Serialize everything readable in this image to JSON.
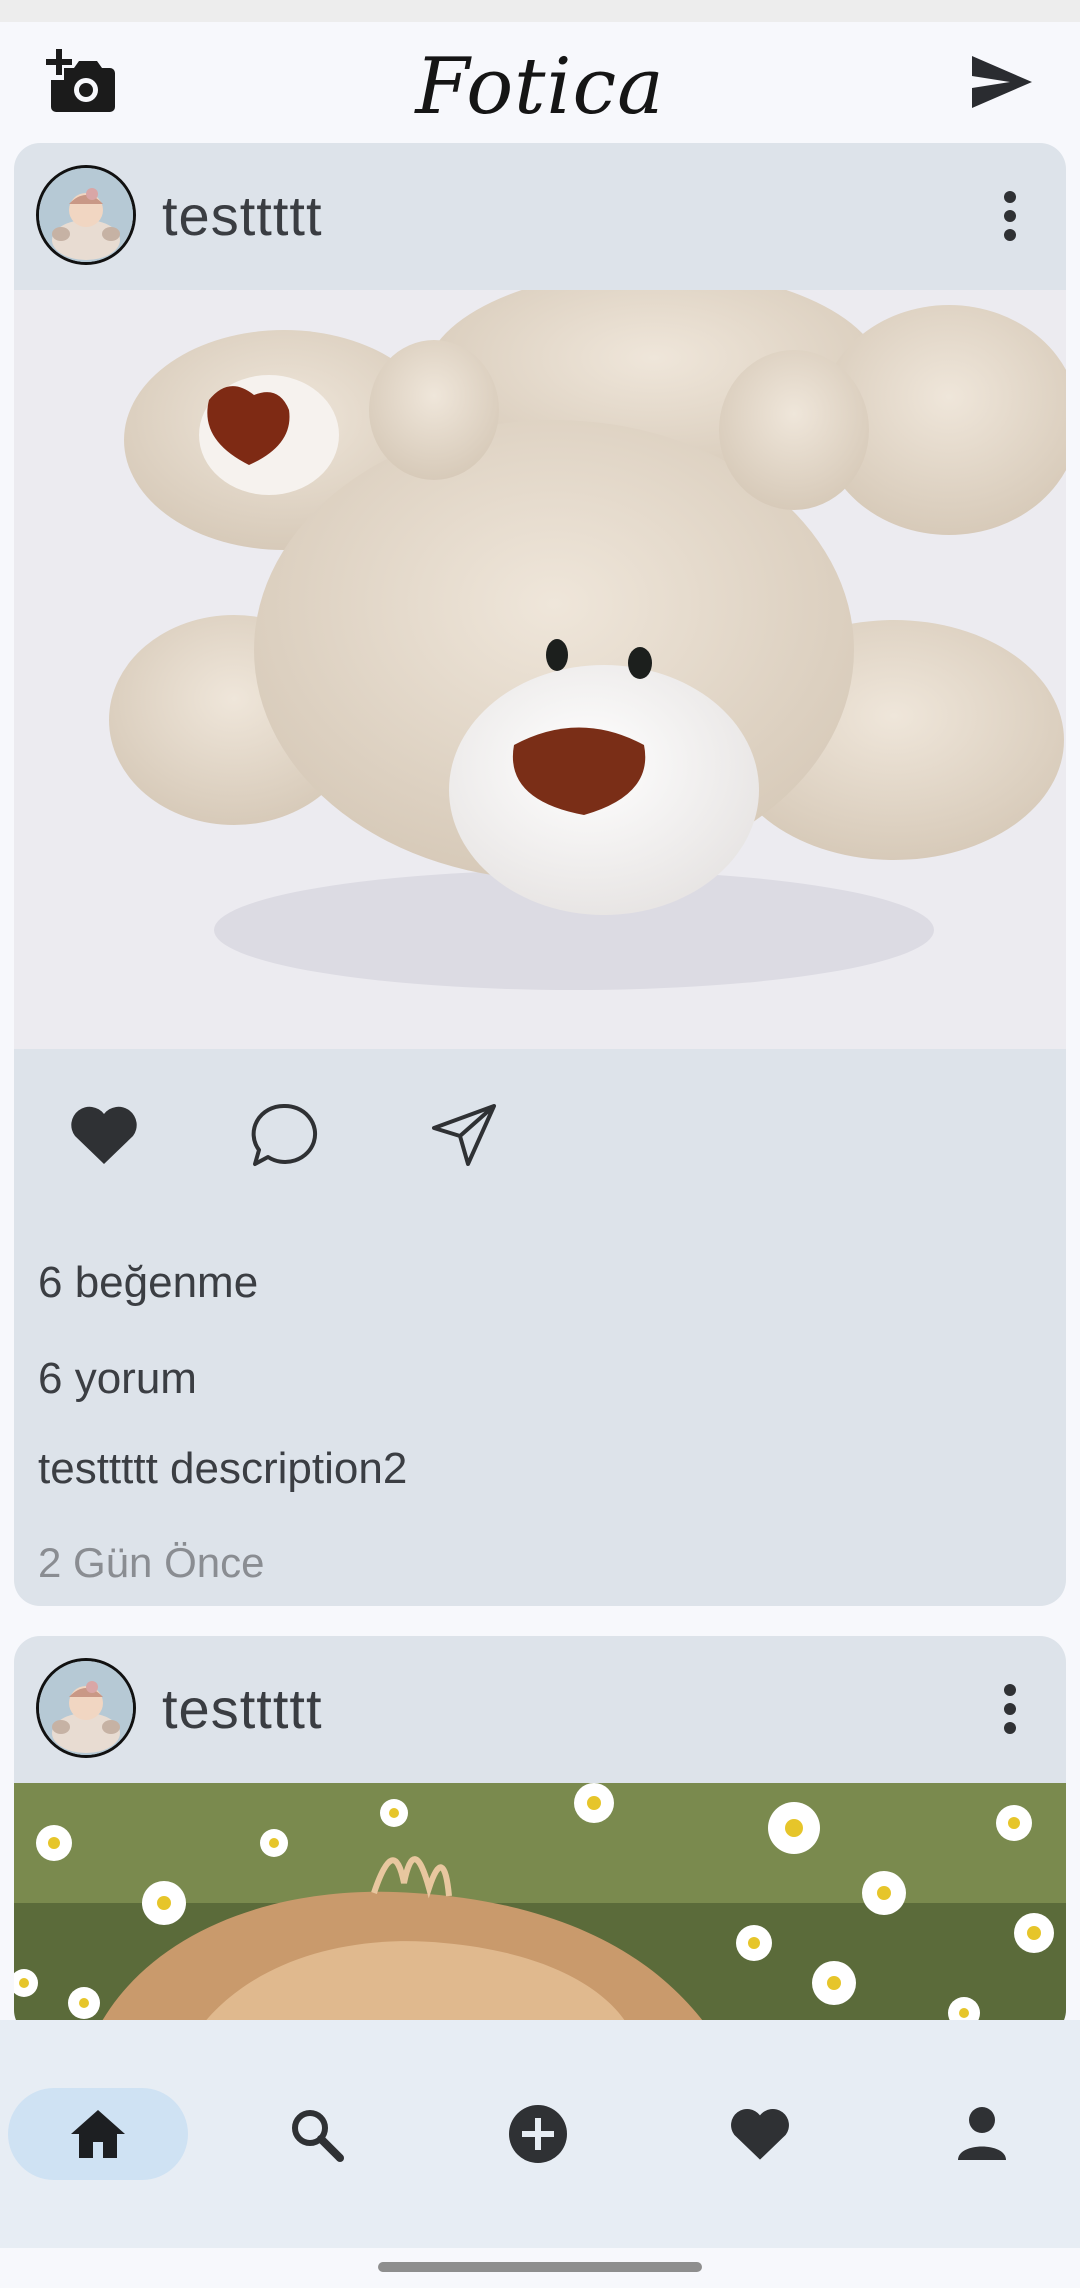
{
  "app": {
    "title": "Fotica"
  },
  "icons": {
    "camera": "add-photo-icon",
    "send": "send-icon",
    "more": "more-vert-icon",
    "like": "heart-icon",
    "comment": "comment-bubble-icon",
    "share": "paper-plane-icon"
  },
  "posts": [
    {
      "username": "testtttt",
      "likes": "6 beğenme",
      "comments": "6 yorum",
      "caption": "testtttt description2",
      "time": "2 Gün Önce",
      "image": "teddy-bear-photo"
    },
    {
      "username": "testtttt",
      "image": "dog-in-daisies-photo"
    }
  ],
  "nav": {
    "items": [
      "home",
      "search",
      "add",
      "likes",
      "profile"
    ],
    "active": "home"
  },
  "colors": {
    "background": "#f7f8fc",
    "card": "#dde3ea",
    "nav_background": "#e7edf4",
    "nav_active": "#cfe2f3",
    "icon": "#2f3134"
  }
}
